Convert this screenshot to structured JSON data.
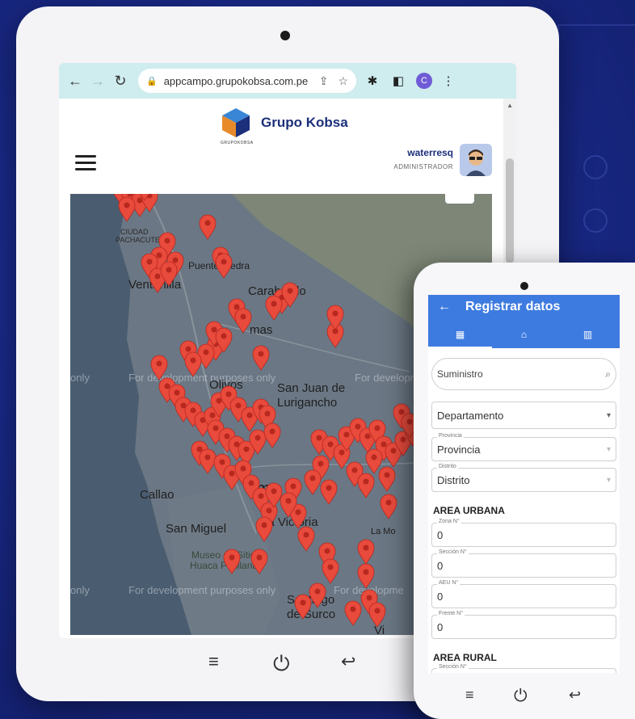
{
  "browser": {
    "url": "appcampo.grupokobsa.com.pe",
    "profile_initial": "C"
  },
  "app": {
    "brand_name": "Grupo Kobsa",
    "brand_sub": "GRUPOKOBSA",
    "user_name": "waterresq",
    "user_role": "ADMINISTRADOR"
  },
  "map": {
    "labels": {
      "ciudad": "CIUDAD",
      "pachacutec": "PACHACUTEC",
      "ventanilla": "Ventanilla",
      "puente_piedra": "Puente Piedra",
      "carabayllo": "Carabayllo",
      "olivos": "Olivos",
      "comas": "mas",
      "sjl_1": "San Juan de",
      "sjl_2": "Lurigancho",
      "callao": "Callao",
      "lima": "ma",
      "san_miguel": "San Miguel",
      "huaca_1": "Museo de Sitio",
      "huaca_2": "Huaca Pucllana",
      "la_victoria": "La Victoria",
      "santiago_1": "Santiago",
      "santiago_2": "de Surco",
      "la_molina": "La Mo",
      "vi": "Vi"
    },
    "dev_text": "For development purposes only",
    "dev_text_short": "For developme",
    "dev_only": "only",
    "marker_color": "#e84a3c"
  },
  "phone": {
    "title": "Registrar datos",
    "search_placeholder": "Suministro",
    "departamento": "Departamento",
    "provincia_label": "Provincia",
    "provincia_value": "Provincia",
    "distrito_label": "Distrito",
    "distrito_value": "Distrito",
    "area_urbana": "AREA URBANA",
    "zona_label": "Zona N°",
    "zona_value": "0",
    "seccion_label": "Sección N°",
    "seccion_value": "0",
    "aeu_label": "AEU N°",
    "aeu_value": "0",
    "frente_label": "Frente N°",
    "frente_value": "0",
    "area_rural": "AREA RURAL",
    "seccion_rural_label": "Sección N°"
  },
  "colors": {
    "phone_bar": "#3e7be0",
    "brand_navy": "#1c2f7a",
    "url_bar": "#cfecee"
  }
}
